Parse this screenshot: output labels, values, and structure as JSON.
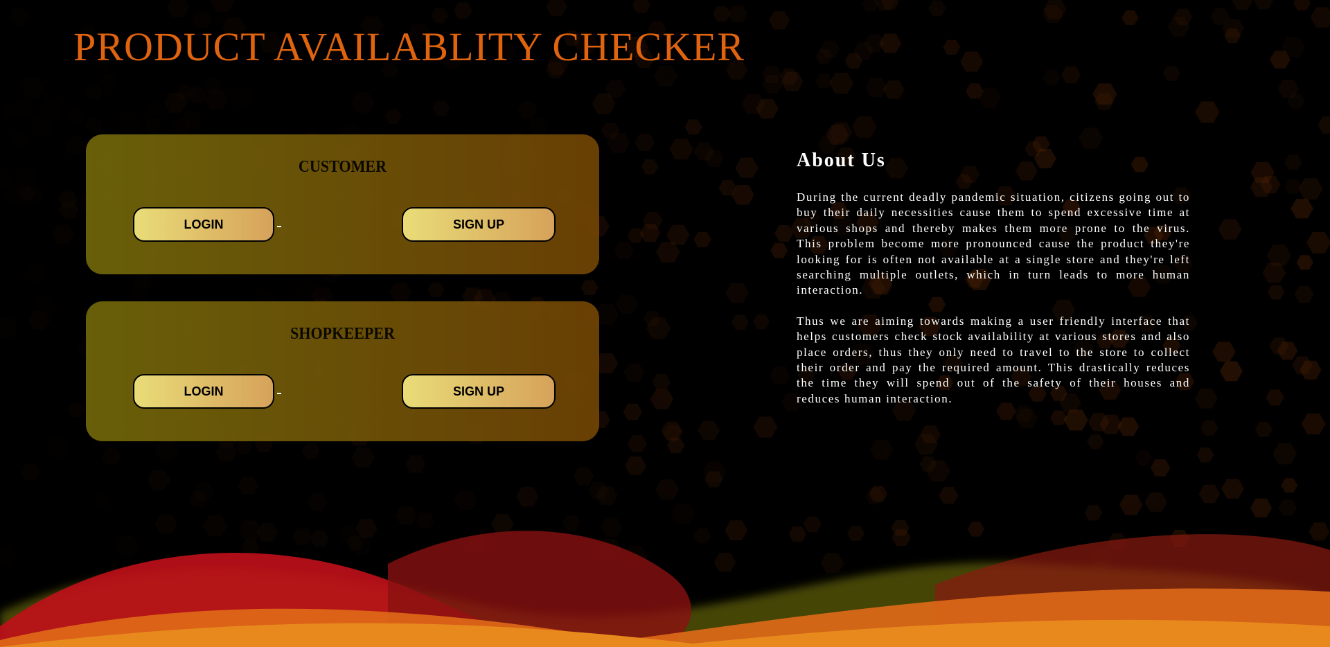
{
  "header": {
    "title": "PRODUCT AVAILABLITY CHECKER"
  },
  "colors": {
    "title": "#e0640f",
    "button_start": "#e9dc78",
    "button_end": "#d6a25a"
  },
  "cards": [
    {
      "heading": "CUSTOMER",
      "login_label": "LOGIN",
      "signup_label": "SIGN UP"
    },
    {
      "heading": "SHOPKEEPER",
      "login_label": "LOGIN",
      "signup_label": "SIGN UP"
    }
  ],
  "about": {
    "heading": "About Us",
    "paragraphs": [
      "During the current deadly pandemic situation, citizens going out to buy their daily necessities cause them to spend excessive time at various shops and thereby makes them more prone to the virus. This problem become more pronounced cause the product they're looking for is often not available at a single store and they're left searching multiple outlets, which in turn leads to more human interaction.",
      "Thus we are aiming towards making a user friendly interface that helps customers check stock availability at various stores and also place orders, thus they only need to travel to the store to collect their order and pay the required amount. This drastically reduces the time they will spend out of the safety of their houses and reduces human interaction."
    ]
  }
}
